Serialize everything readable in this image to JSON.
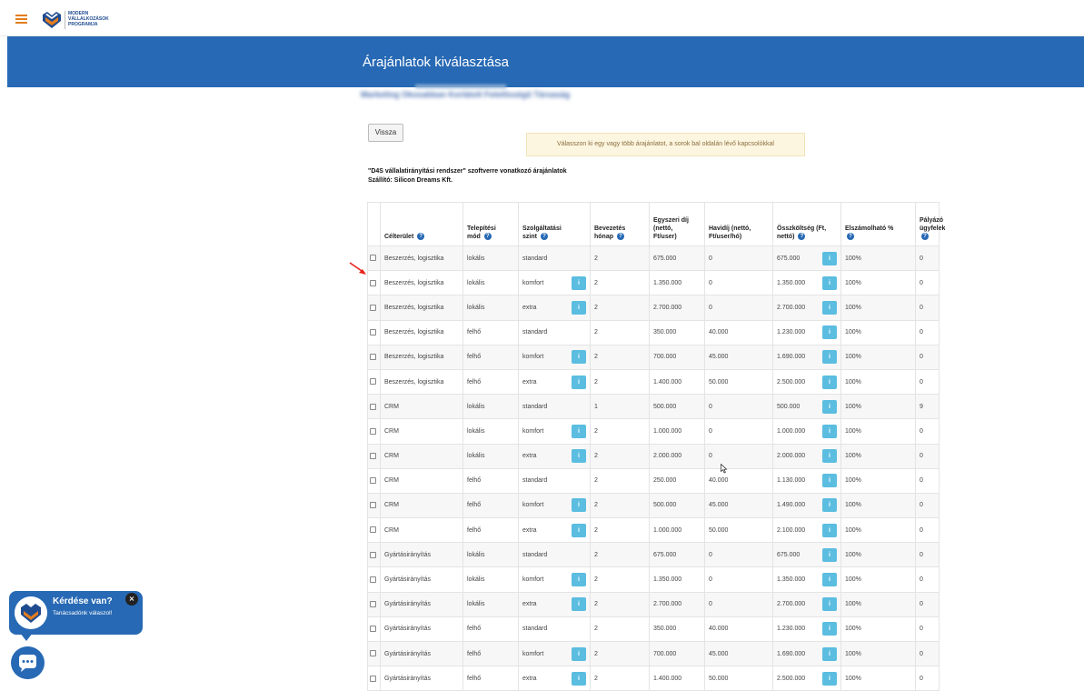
{
  "header": {
    "logo_lines": [
      "MODERN",
      "VÁLLALKOZÁSOK",
      "PROGRAMJA"
    ],
    "icons": {
      "menu": "hamburger-icon",
      "logo": "mvp-logo-icon"
    },
    "accent_color": "#e37d1e",
    "brand_color": "#1f4b8f"
  },
  "banner": {
    "title": "Árajánlatok kiválasztása",
    "company": "Marketing Okosabban Korlátolt Felelősségű Társaság",
    "color": "#2769b4"
  },
  "actions": {
    "back_label": "Vissza"
  },
  "alert": {
    "text": "Válasszon ki egy vagy több árajánlatot, a sorok bal oldalán lévő kapcsolókkal"
  },
  "software": {
    "title": "\"D4S vállalatirányítási rendszer\" szoftverre vonatkozó árajánlatok",
    "supplier": "Szállító: Silicon Dreams Kft."
  },
  "table": {
    "info_glyph": "i",
    "help_glyph": "?",
    "headers": {
      "target": "Célterület",
      "install_1": "Telepítési",
      "install_2": "mód",
      "service_1": "Szolgáltatási",
      "service_2": "szint",
      "intro_1": "Bevezetés",
      "intro_2": "hónap",
      "onetime_1": "Egyszeri díj",
      "onetime_2": "(nettó,",
      "onetime_3": "Ft/user)",
      "monthly_1": "Havidíj (nettó,",
      "monthly_2": "Ft/user/hó)",
      "total_1": "Összköltség (Ft,",
      "total_2": "nettó)",
      "eligible": "Elszámolható %",
      "clients_1": "Pályázó",
      "clients_2": "ügyfelek"
    },
    "rows": [
      {
        "target": "Beszerzés, logisztika",
        "install": "lokális",
        "level": "standard",
        "months": "2",
        "onetime": "675.000",
        "monthly": "0",
        "total": "675.000",
        "eligible": "100%",
        "clients": "0"
      },
      {
        "target": "Beszerzés, logisztika",
        "install": "lokális",
        "level": "komfort",
        "months": "2",
        "onetime": "1.350.000",
        "monthly": "0",
        "total": "1.350.000",
        "eligible": "100%",
        "clients": "0"
      },
      {
        "target": "Beszerzés, logisztika",
        "install": "lokális",
        "level": "extra",
        "months": "2",
        "onetime": "2.700.000",
        "monthly": "0",
        "total": "2.700.000",
        "eligible": "100%",
        "clients": "0"
      },
      {
        "target": "Beszerzés, logisztika",
        "install": "felhő",
        "level": "standard",
        "months": "2",
        "onetime": "350.000",
        "monthly": "40.000",
        "total": "1.230.000",
        "eligible": "100%",
        "clients": "0"
      },
      {
        "target": "Beszerzés, logisztika",
        "install": "felhő",
        "level": "komfort",
        "months": "2",
        "onetime": "700.000",
        "monthly": "45.000",
        "total": "1.690.000",
        "eligible": "100%",
        "clients": "0"
      },
      {
        "target": "Beszerzés, logisztika",
        "install": "felhő",
        "level": "extra",
        "months": "2",
        "onetime": "1.400.000",
        "monthly": "50.000",
        "total": "2.500.000",
        "eligible": "100%",
        "clients": "0"
      },
      {
        "target": "CRM",
        "install": "lokális",
        "level": "standard",
        "months": "1",
        "onetime": "500.000",
        "monthly": "0",
        "total": "500.000",
        "eligible": "100%",
        "clients": "9"
      },
      {
        "target": "CRM",
        "install": "lokális",
        "level": "komfort",
        "months": "2",
        "onetime": "1.000.000",
        "monthly": "0",
        "total": "1.000.000",
        "eligible": "100%",
        "clients": "0"
      },
      {
        "target": "CRM",
        "install": "lokális",
        "level": "extra",
        "months": "2",
        "onetime": "2.000.000",
        "monthly": "0",
        "total": "2.000.000",
        "eligible": "100%",
        "clients": "0"
      },
      {
        "target": "CRM",
        "install": "felhő",
        "level": "standard",
        "months": "2",
        "onetime": "250.000",
        "monthly": "40.000",
        "total": "1.130.000",
        "eligible": "100%",
        "clients": "0"
      },
      {
        "target": "CRM",
        "install": "felhő",
        "level": "komfort",
        "months": "2",
        "onetime": "500.000",
        "monthly": "45.000",
        "total": "1.490.000",
        "eligible": "100%",
        "clients": "0"
      },
      {
        "target": "CRM",
        "install": "felhő",
        "level": "extra",
        "months": "2",
        "onetime": "1.000.000",
        "monthly": "50.000",
        "total": "2.100.000",
        "eligible": "100%",
        "clients": "0"
      },
      {
        "target": "Gyártásirányítás",
        "install": "lokális",
        "level": "standard",
        "months": "2",
        "onetime": "675.000",
        "monthly": "0",
        "total": "675.000",
        "eligible": "100%",
        "clients": "0"
      },
      {
        "target": "Gyártásirányítás",
        "install": "lokális",
        "level": "komfort",
        "months": "2",
        "onetime": "1.350.000",
        "monthly": "0",
        "total": "1.350.000",
        "eligible": "100%",
        "clients": "0"
      },
      {
        "target": "Gyártásirányítás",
        "install": "lokális",
        "level": "extra",
        "months": "2",
        "onetime": "2.700.000",
        "monthly": "0",
        "total": "2.700.000",
        "eligible": "100%",
        "clients": "0"
      },
      {
        "target": "Gyártásirányítás",
        "install": "felhő",
        "level": "standard",
        "months": "2",
        "onetime": "350.000",
        "monthly": "40.000",
        "total": "1.230.000",
        "eligible": "100%",
        "clients": "0"
      },
      {
        "target": "Gyártásirányítás",
        "install": "felhő",
        "level": "komfort",
        "months": "2",
        "onetime": "700.000",
        "monthly": "45.000",
        "total": "1.690.000",
        "eligible": "100%",
        "clients": "0"
      },
      {
        "target": "Gyártásirányítás",
        "install": "felhő",
        "level": "extra",
        "months": "2",
        "onetime": "1.400.000",
        "monthly": "50.000",
        "total": "2.500.000",
        "eligible": "100%",
        "clients": "0"
      }
    ]
  },
  "chat": {
    "title": "Kérdése van?",
    "subtitle": "Tanácsadónk válaszol!",
    "close_glyph": "×",
    "icons": {
      "close": "close-icon",
      "launcher": "chat-icon"
    }
  },
  "overlay": {
    "arrow_color": "#e8221c"
  }
}
